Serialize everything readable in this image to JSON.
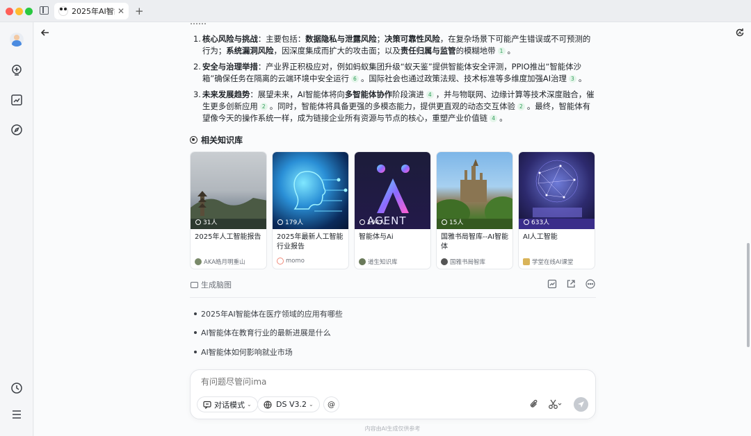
{
  "window": {
    "tab_title": "2025年AI智能体",
    "tab_close": "✕",
    "tab_add": "+"
  },
  "answer": {
    "partial_top": "……",
    "points": [
      {
        "num": "1.",
        "segments": [
          {
            "t": "核心风险与挑战",
            "b": true
          },
          {
            "t": "：主要包括："
          },
          {
            "t": "数据隐私与泄露风险",
            "b": true
          },
          {
            "t": "；"
          },
          {
            "t": "决策可靠性风险",
            "b": true
          },
          {
            "t": "，在复杂场景下可能产生错误或不可预测的行为；"
          },
          {
            "t": "系统漏洞风险",
            "b": true
          },
          {
            "t": "，因深度集成而扩大的攻击面；以及"
          },
          {
            "t": "责任归属与监管",
            "b": true
          },
          {
            "t": "的模糊地带"
          },
          {
            "c": "1"
          },
          {
            "t": "。"
          }
        ]
      },
      {
        "num": "2.",
        "segments": [
          {
            "t": "安全与治理举措",
            "b": true
          },
          {
            "t": "：产业界正积极应对，例如蚂蚁集团升级“蚁天鉴”提供智能体安全评测，PPIO推出“智能体沙箱”确保任务在隔离的云端环境中安全运行"
          },
          {
            "c": "6"
          },
          {
            "t": "。国际社会也通过政策法规、技术标准等多维度加强AI治理"
          },
          {
            "c": "3"
          },
          {
            "t": "。"
          }
        ]
      },
      {
        "num": "3.",
        "segments": [
          {
            "t": "未来发展趋势",
            "b": true
          },
          {
            "t": "：展望未来，AI智能体将向"
          },
          {
            "t": "多智能体协作",
            "b": true
          },
          {
            "t": "阶段演进"
          },
          {
            "c": "4"
          },
          {
            "t": "，并与物联网、边缘计算等技术深度融合，催生更多创新应用"
          },
          {
            "c": "2"
          },
          {
            "t": "。同时，智能体将具备更强的多模态能力，提供更直观的动态交互体验"
          },
          {
            "c": "2"
          },
          {
            "t": "。最终，智能体有望像今天的操作系统一样，成为链接企业所有资源与节点的核心，重塑产业价值链"
          },
          {
            "c": "4"
          },
          {
            "t": "。"
          }
        ]
      }
    ]
  },
  "knowledge": {
    "heading": "相关知识库",
    "cards": [
      {
        "members": "31人",
        "title": "2025年人工智能报告",
        "owner": "AKA皓月明重山",
        "owner_color": "#7a8a6a"
      },
      {
        "members": "179人",
        "title": "2025年最新人工智能行业报告",
        "owner": "momo",
        "owner_color": "#f08a7a"
      },
      {
        "members": "194人",
        "title": "智能体与Ai",
        "owner": "道生知识库",
        "owner_color": "#6a7a5a",
        "logo_text": "AGENT"
      },
      {
        "members": "15人",
        "title": "国雅书局智库--AI智能体",
        "owner": "国雅书局智库",
        "owner_color": "#555"
      },
      {
        "members": "633人",
        "title": "AI人工智能",
        "owner": "学堂在线AI课堂",
        "owner_color": "#d9b45a"
      }
    ]
  },
  "actions": {
    "mindmap": "生成脑图"
  },
  "suggestions": [
    "2025年AI智能体在医疗领域的应用有哪些",
    "AI智能体在教育行业的最新进展是什么",
    "AI智能体如何影响就业市场"
  ],
  "input": {
    "placeholder": "有问题尽管问ima",
    "mode_label": "对话模式",
    "model_label": "DS V3.2",
    "at_label": "@"
  },
  "footer": "内容由AI生成仅供参考"
}
